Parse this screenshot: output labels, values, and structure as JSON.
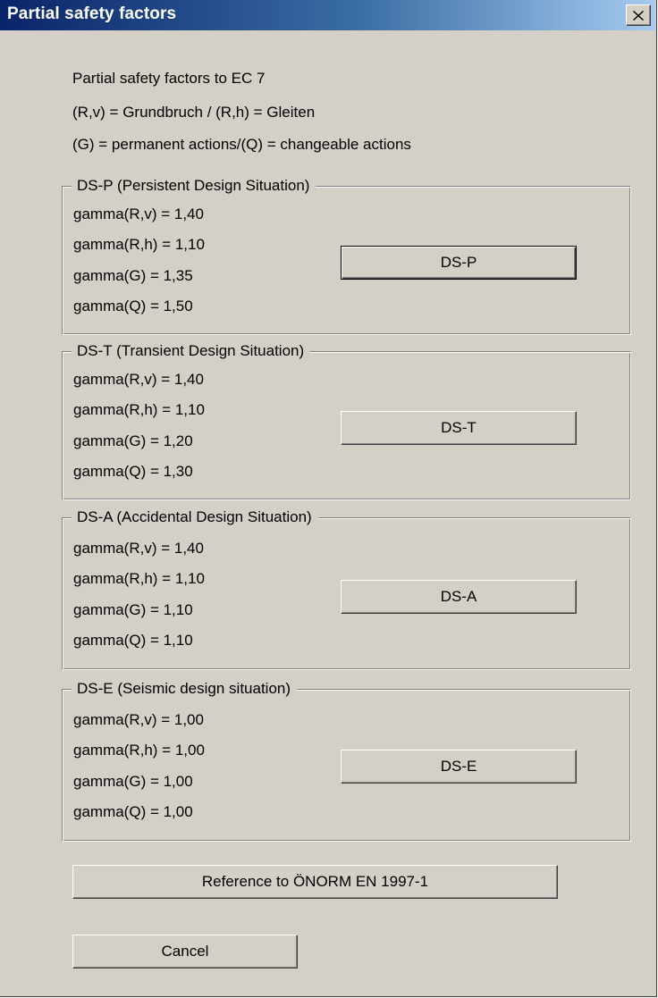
{
  "window": {
    "title": "Partial safety factors",
    "close_icon": "close-icon"
  },
  "intro": [
    "Partial safety factors to EC 7",
    "(R,v) = Grundbruch / (R,h) = Gleiten",
    "(G) = permanent actions/(Q) = changeable actions"
  ],
  "groups": [
    {
      "legend": "DS-P (Persistent Design Situation)",
      "lines": [
        "gamma(R,v) = 1,40",
        "gamma(R,h) = 1,10",
        "gamma(G) = 1,35",
        "gamma(Q) = 1,50"
      ],
      "button": "DS-P"
    },
    {
      "legend": "DS-T (Transient Design Situation)",
      "lines": [
        "gamma(R,v) = 1,40",
        "gamma(R,h) = 1,10",
        "gamma(G) = 1,20",
        "gamma(Q) = 1,30"
      ],
      "button": "DS-T"
    },
    {
      "legend": "DS-A (Accidental Design Situation)",
      "lines": [
        "gamma(R,v) = 1,40",
        "gamma(R,h) = 1,10",
        "gamma(G) = 1,10",
        "gamma(Q) = 1,10"
      ],
      "button": "DS-A"
    },
    {
      "legend": "DS-E (Seismic design situation)",
      "lines": [
        "gamma(R,v) = 1,00",
        "gamma(R,h) = 1,00",
        "gamma(G) = 1,00",
        "gamma(Q) = 1,00"
      ],
      "button": "DS-E"
    }
  ],
  "buttons": {
    "reference": "Reference to ÖNORM EN 1997-1",
    "cancel": "Cancel"
  },
  "colors": {
    "dialog_face": "#d4d0c8",
    "titlebar_start": "#0a246a",
    "titlebar_end": "#a6caf0",
    "title_text": "#ffffff"
  }
}
